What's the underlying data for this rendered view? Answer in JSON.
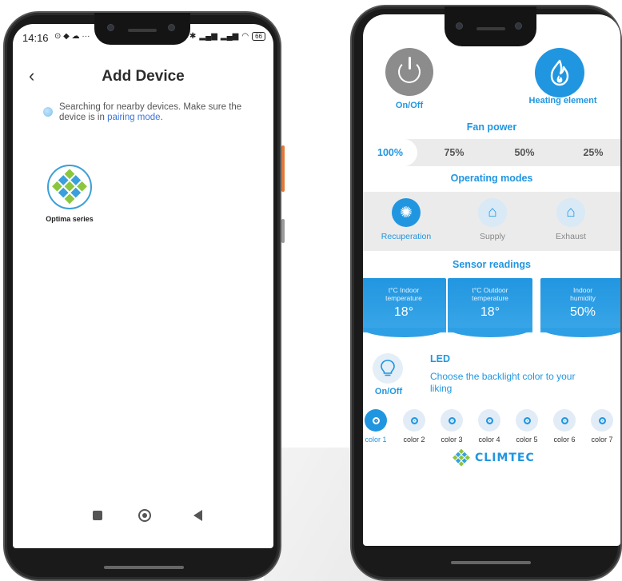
{
  "left_phone": {
    "status_time": "14:16",
    "status_icons": "⊙ ◆ ☁ ···",
    "battery": "66",
    "title": "Add Device",
    "searching_text": "Searching for nearby devices. Make sure the device is in ",
    "pairing_link": "pairing mode",
    "searching_suffix": ".",
    "device_name": "Optima series"
  },
  "right_phone": {
    "power_label": "On/Off",
    "heating_label": "Heating element",
    "fan_power_title": "Fan power",
    "fan_options": [
      "100%",
      "75%",
      "50%",
      "25%"
    ],
    "fan_selected": "100%",
    "modes_title": "Operating modes",
    "modes": [
      "Recuperation",
      "Supply",
      "Exhaust"
    ],
    "mode_selected": "Recuperation",
    "sensors_title": "Sensor readings",
    "sensors": [
      {
        "label": "t°C Indoor temperature",
        "value": "18°"
      },
      {
        "label": "t°C Outdoor temperature",
        "value": "18°"
      },
      {
        "label": "Indoor humidity",
        "value": "50%"
      }
    ],
    "led_title": "LED",
    "led_desc": "Choose the backlight color to your liking",
    "led_onoff": "On/Off",
    "colors": [
      "color 1",
      "color 2",
      "color 3",
      "color 4",
      "color 5",
      "color 6",
      "color 7"
    ],
    "color_selected": "color 1",
    "brand": "CLIMTEC"
  },
  "colors": {
    "accent": "#2196e0",
    "power_off_gray": "#8c8c8c",
    "panel_gray": "#ebebeb"
  }
}
